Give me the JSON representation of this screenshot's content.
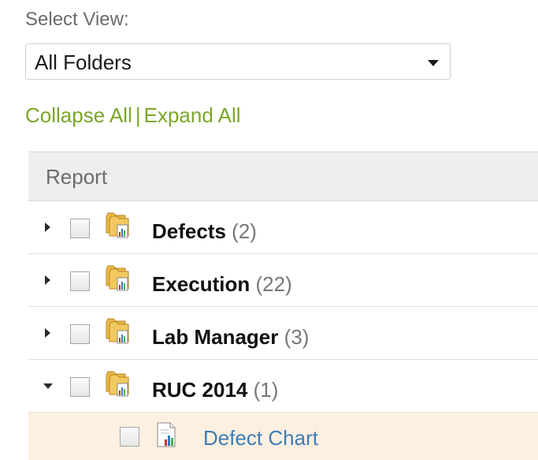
{
  "view_selector": {
    "label": "Select View:",
    "selected": "All Folders"
  },
  "tree_controls": {
    "collapse_label": "Collapse All",
    "separator": "|",
    "expand_label": "Expand All"
  },
  "tree": {
    "header": "Report",
    "folders": [
      {
        "name": "Defects",
        "count": "(2)",
        "expanded": false
      },
      {
        "name": "Execution",
        "count": "(22)",
        "expanded": false
      },
      {
        "name": "Lab Manager",
        "count": "(3)",
        "expanded": false
      },
      {
        "name": "RUC 2014",
        "count": "(1)",
        "expanded": true
      }
    ],
    "children": [
      {
        "name": "Defect Chart"
      }
    ]
  },
  "colors": {
    "link_green": "#7aa62a",
    "link_blue": "#3d7db5",
    "selected_row_bg": "#fdf0e1",
    "header_bg": "#eeeeee"
  }
}
